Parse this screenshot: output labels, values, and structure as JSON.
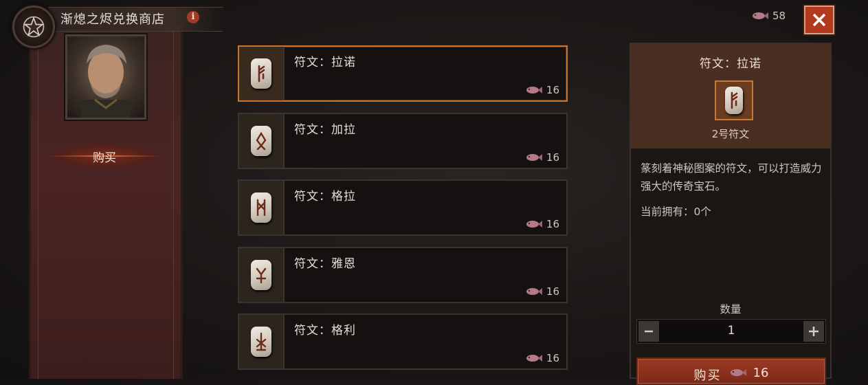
{
  "header": {
    "title": "渐熄之烬兑换商店",
    "info_icon": "i",
    "currency_amount": "58",
    "currency_icon": "ember-icon",
    "close_icon": "close-icon"
  },
  "sidebar": {
    "buy_tab_label": "购买"
  },
  "items": [
    {
      "name": "符文：拉诺",
      "price": "16",
      "selected": true
    },
    {
      "name": "符文：加拉",
      "price": "16",
      "selected": false
    },
    {
      "name": "符文：格拉",
      "price": "16",
      "selected": false
    },
    {
      "name": "符文：雅恩",
      "price": "16",
      "selected": false
    },
    {
      "name": "符文：格利",
      "price": "16",
      "selected": false
    }
  ],
  "detail": {
    "title": "符文：拉诺",
    "subtitle": "2号符文",
    "description": "篆刻着神秘图案的符文，可以打造威力强大的传奇宝石。",
    "owned": "当前拥有：0个",
    "quantity_label": "数量",
    "quantity_value": "1",
    "minus_label": "—",
    "plus_label": "+",
    "buy_label": "购买",
    "buy_price": "16"
  },
  "colors": {
    "accent": "#c9742f",
    "close_red": "#b3391f",
    "buy_red": "#9a3a23"
  }
}
